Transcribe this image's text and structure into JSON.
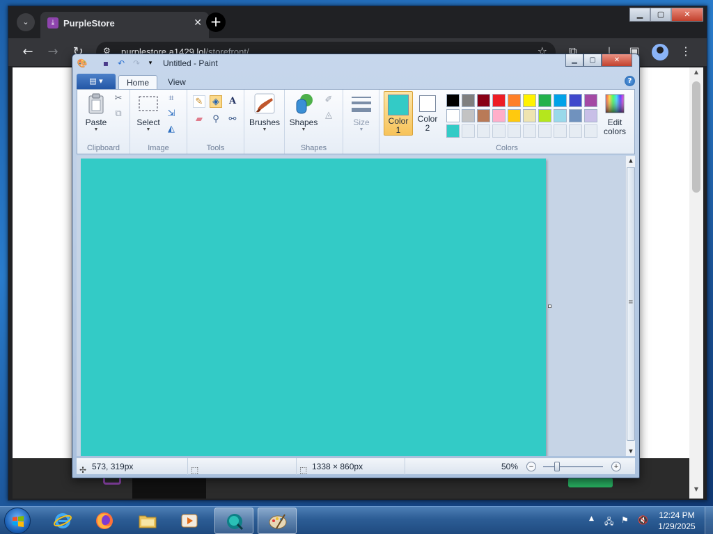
{
  "browser": {
    "tab_title": "PurpleStore",
    "tab_close": "✕",
    "new_tab": "+",
    "url_host": "purplestore.a1429.lol",
    "url_path": "/storefront/",
    "controls": {
      "minimize": "▁",
      "maximize": "▢",
      "close": "✕"
    }
  },
  "paint": {
    "window_title": "Untitled - Paint",
    "tabs": [
      "Home",
      "View"
    ],
    "active_tab": "Home",
    "controls": {
      "minimize": "▁",
      "maximize": "▢",
      "close": "✕"
    },
    "groups": {
      "clipboard": {
        "label": "Clipboard",
        "paste": "Paste"
      },
      "image": {
        "label": "Image",
        "select": "Select"
      },
      "tools": {
        "label": "Tools"
      },
      "brushes": {
        "label": "Brushes"
      },
      "shapes": {
        "label": "Shapes",
        "shapes": "Shapes"
      },
      "size": {
        "label": "Size"
      },
      "colors": {
        "label": "Colors",
        "color1_line1": "Color",
        "color1_line2": "1",
        "color2_line1": "Color",
        "color2_line2": "2",
        "edit_line1": "Edit",
        "edit_line2": "colors",
        "color1_value": "#33cbc6",
        "color2_value": "#ffffff",
        "palette": [
          [
            "#000000",
            "#7f7f7f",
            "#880015",
            "#ed1c24",
            "#ff7f27",
            "#fff200",
            "#22b14c",
            "#00a2e8",
            "#3f48cc",
            "#a349a4"
          ],
          [
            "#ffffff",
            "#c3c3c3",
            "#b97a57",
            "#ffaec9",
            "#ffc90e",
            "#efe4b0",
            "#b5e61d",
            "#99d9ea",
            "#7092be",
            "#c8bfe7"
          ],
          [
            "#33cbc6",
            "",
            "",
            "",
            "",
            "",
            "",
            "",
            "",
            ""
          ]
        ]
      }
    },
    "canvas_color": "#33cbc6",
    "status": {
      "cursor_pos": "573, 319px",
      "image_size": "1338 × 860px",
      "zoom": "50%"
    }
  },
  "taskbar": {
    "time": "12:24 PM",
    "date": "1/29/2025"
  }
}
